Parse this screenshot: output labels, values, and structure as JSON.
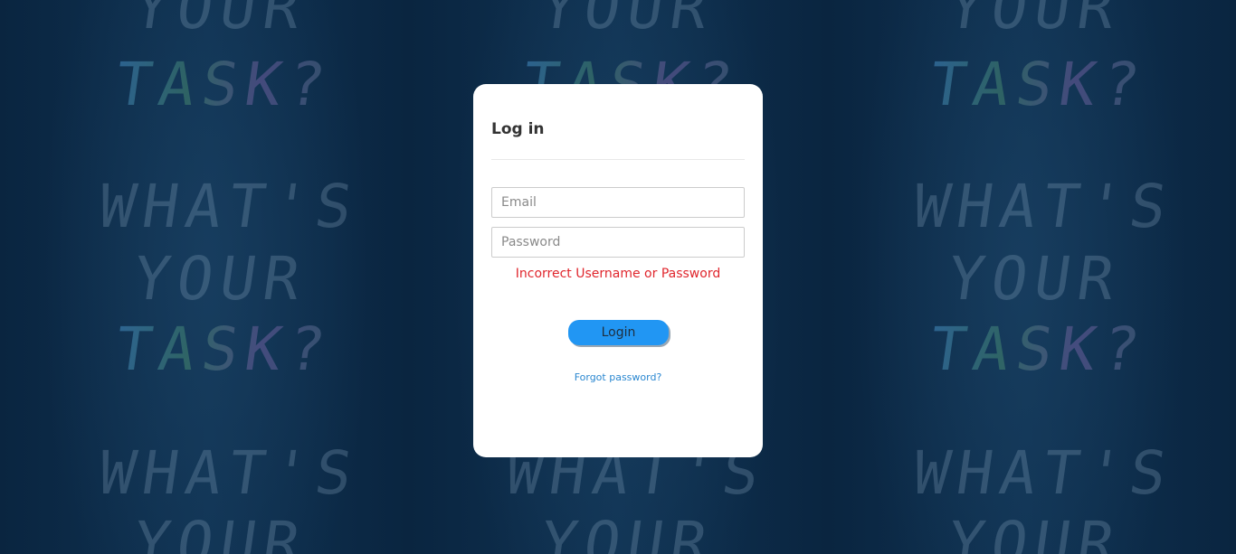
{
  "background": {
    "word_lines": [
      "YOUR",
      "TASK?",
      "WHAT'S",
      "YOUR",
      "TASK?",
      "WHAT'S",
      "YOUR"
    ]
  },
  "login_card": {
    "title": "Log in",
    "email": {
      "placeholder": "Email",
      "value": ""
    },
    "password": {
      "placeholder": "Password",
      "value": ""
    },
    "error_message": "Incorrect Username or Password",
    "login_button_label": "Login",
    "forgot_password_label": "Forgot password?"
  },
  "colors": {
    "accent": "#2196f3",
    "error": "#e0262d",
    "link": "#2a87d0",
    "background": "#0b2a45"
  }
}
